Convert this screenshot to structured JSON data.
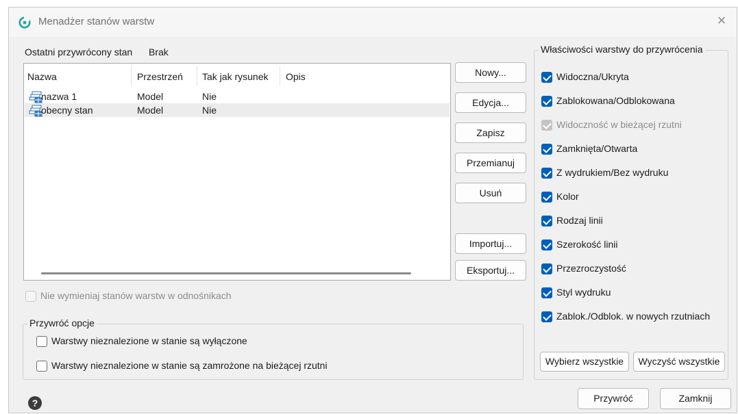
{
  "window": {
    "title": "Menadżer stanów warstw",
    "close_glyph": "×"
  },
  "last_restored": {
    "label": "Ostatni przywrócony stan",
    "value": "Brak"
  },
  "table": {
    "headers": [
      "Nazwa",
      "Przestrzeń",
      "Tak jak rysunek",
      "Opis"
    ],
    "rows": [
      {
        "name": "nazwa 1",
        "space": "Model",
        "as_drawing": "Nie",
        "desc": "",
        "icon": "layer-state-icon"
      },
      {
        "name": "obecny stan",
        "space": "Model",
        "as_drawing": "Nie",
        "desc": "",
        "icon": "layer-state-icon",
        "selected": true
      }
    ]
  },
  "buttons": {
    "new": "Nowy...",
    "edit": "Edycja...",
    "save": "Zapisz",
    "rename": "Przemianuj",
    "delete": "Usuń",
    "import": "Importuj...",
    "export": "Eksportuj...",
    "select_all": "Wybierz wszystkie",
    "clear_all": "Wyczyść wszystkie",
    "restore": "Przywróć",
    "close": "Zamknij"
  },
  "no_xref": {
    "label": "Nie wymieniaj stanów warstw w odnośnikach",
    "checked": false,
    "disabled": true
  },
  "restore_options": {
    "title": "Przywróć opcje",
    "items": [
      {
        "label": "Warstwy nieznalezione w stanie są wyłączone",
        "checked": false
      },
      {
        "label": "Warstwy nieznalezione w stanie są zamrożone na bieżącej rzutni",
        "checked": false
      }
    ]
  },
  "properties": {
    "title": "Właściwości warstwy do przywrócenia",
    "items": [
      {
        "label": "Widoczna/Ukryta",
        "checked": true
      },
      {
        "label": "Zablokowana/Odblokowana",
        "checked": true
      },
      {
        "label": "Widoczność w bieżącej rzutni",
        "checked": true,
        "disabled": true
      },
      {
        "label": "Zamknięta/Otwarta",
        "checked": true
      },
      {
        "label": "Z wydrukiem/Bez wydruku",
        "checked": true
      },
      {
        "label": "Kolor",
        "checked": true
      },
      {
        "label": "Rodzaj linii",
        "checked": true
      },
      {
        "label": "Szerokość linii",
        "checked": true
      },
      {
        "label": "Przezroczystość",
        "checked": true
      },
      {
        "label": "Styl wydruku",
        "checked": true
      },
      {
        "label": "Zablok./Odblok. w nowych rzutniach",
        "checked": true
      }
    ]
  },
  "colors": {
    "accent": "#005fb8",
    "selection": "#ececec",
    "app_icon": "#1aa6a0"
  }
}
